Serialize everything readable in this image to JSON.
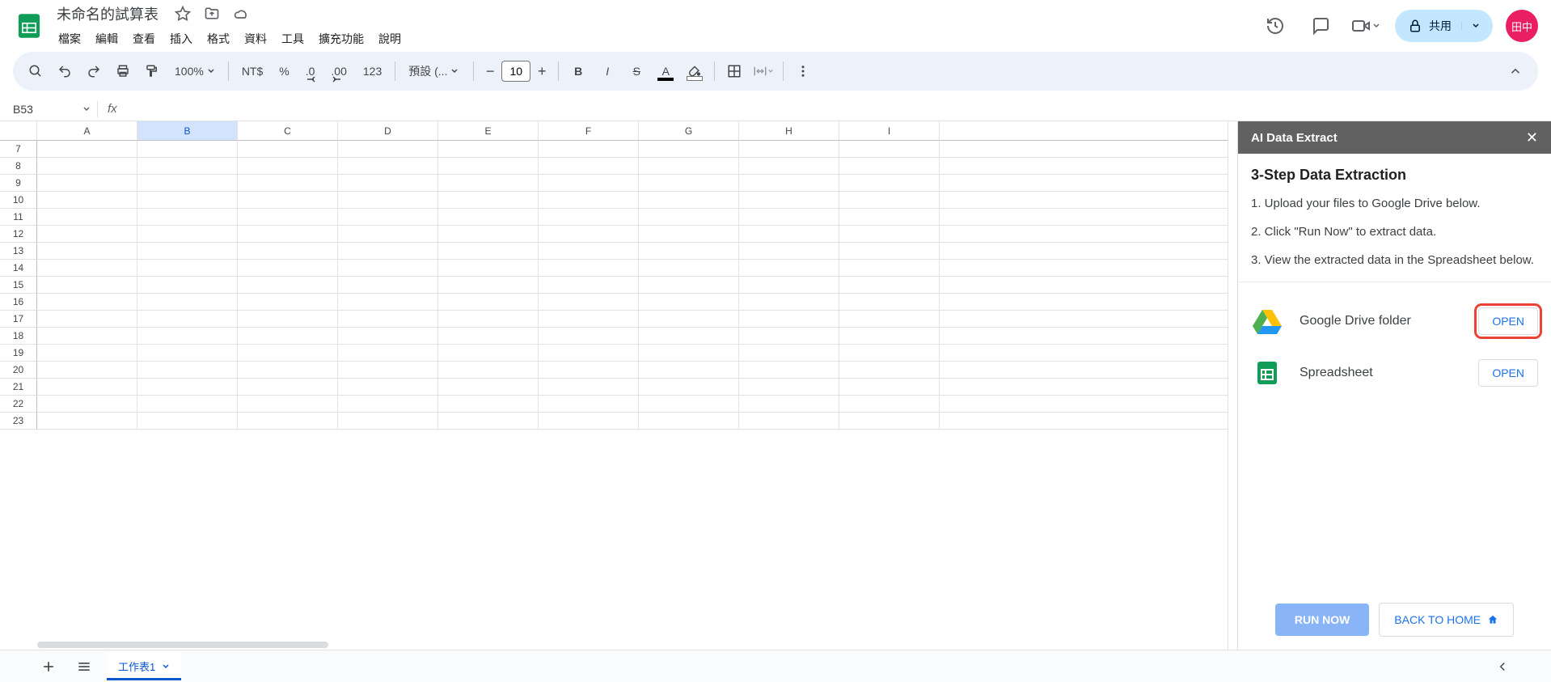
{
  "header": {
    "doc_title": "未命名的試算表",
    "menus": [
      "檔案",
      "編輯",
      "查看",
      "插入",
      "格式",
      "資料",
      "工具",
      "擴充功能",
      "說明"
    ],
    "share_label": "共用",
    "avatar_text": "田中"
  },
  "toolbar": {
    "zoom": "100%",
    "currency": "NT$",
    "percent": "%",
    "dec_dec": ".0",
    "inc_dec": ".00",
    "num123": "123",
    "font_name": "預設 (...",
    "font_size": "10"
  },
  "formula": {
    "name_box": "B53",
    "fx": "fx"
  },
  "grid": {
    "columns": [
      "A",
      "B",
      "C",
      "D",
      "E",
      "F",
      "G",
      "H",
      "I"
    ],
    "rows_start": 7,
    "rows_end": 23,
    "selected_col": "B"
  },
  "panel": {
    "title": "AI Data Extract",
    "heading": "3-Step Data Extraction",
    "steps": [
      "1. Upload your files to Google Drive below.",
      "2. Click \"Run Now\" to extract data.",
      "3. View the extracted data in the Spreadsheet below."
    ],
    "items": [
      {
        "label": "Google Drive folder",
        "button": "OPEN",
        "highlighted": true
      },
      {
        "label": "Spreadsheet",
        "button": "OPEN",
        "highlighted": false
      }
    ],
    "run_label": "RUN NOW",
    "home_label": "BACK TO HOME"
  },
  "sheet_tabs": {
    "tab1": "工作表1"
  }
}
